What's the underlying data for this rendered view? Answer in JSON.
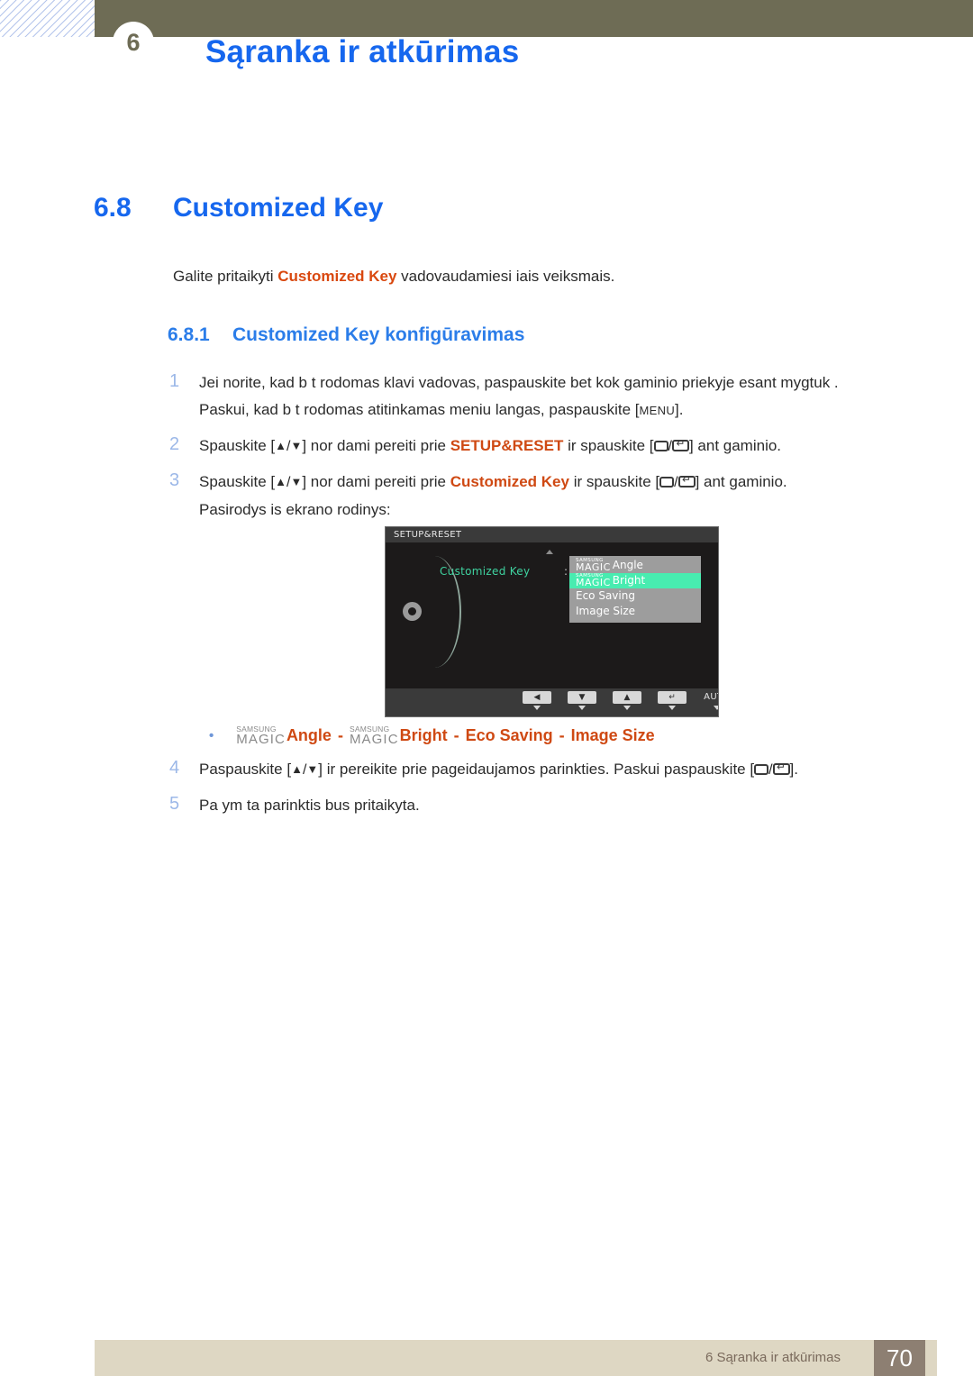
{
  "header": {
    "chapter_badge": "6",
    "chapter_title": "Sąranka ir atkūrimas"
  },
  "section": {
    "number": "6.8",
    "title": "Customized Key"
  },
  "intro": {
    "before": "Galite pritaikyti ",
    "keyword": "Customized Key",
    "after": " vadovaudamiesi  iais veiksmais."
  },
  "subsection": {
    "number": "6.8.1",
    "title": "Customized Key konfigūravimas"
  },
  "steps": [
    {
      "num": "1",
      "line1_a": "Jei norite, kad b t  rodomas klavi",
      "line1_b": " vadovas, paspauskite bet kok  gaminio priekyje esant  mygtuk  .",
      "line2_a": "Paskui, kad b t  rodomas atitinkamas meniu langas, paspauskite [",
      "menu_tag": "MENU",
      "line2_b": "]."
    },
    {
      "num": "2",
      "a": "Spauskite [",
      "b": "] nor dami pereiti prie ",
      "keyword": "SETUP&RESET",
      "c": " ir spauskite [",
      "d": "] ant gaminio."
    },
    {
      "num": "3",
      "a": "Spauskite [",
      "b": "] nor dami pereiti prie ",
      "keyword": "Customized Key",
      "c": " ir spauskite [",
      "d": "] ant gaminio.",
      "line2": "Pasirodys  is ekrano rodinys:"
    },
    {
      "num": "4",
      "a": "Paspauskite [",
      "b": "] ir pereikite prie pageidaujamos parinkties. Paskui paspauskite [",
      "c": "]."
    },
    {
      "num": "5",
      "a": "Pa ym ta parinktis bus pritaikyta."
    }
  ],
  "osd": {
    "title": "SETUP&RESET",
    "menu_label": "Customized Key",
    "colon": ":",
    "items": [
      {
        "magic_top": "SAMSUNG",
        "magic_bot": "MAGIC",
        "label": "Angle",
        "selected": false
      },
      {
        "magic_top": "SAMSUNG",
        "magic_bot": "MAGIC",
        "label": "Bright",
        "selected": true
      },
      {
        "magic_top": "",
        "magic_bot": "",
        "label": "Eco Saving",
        "selected": false
      },
      {
        "magic_top": "",
        "magic_bot": "",
        "label": "Image Size",
        "selected": false
      }
    ],
    "buttons": [
      {
        "glyph": "◀",
        "name": "left-arrow"
      },
      {
        "glyph": "▼",
        "name": "down-arrow"
      },
      {
        "glyph": "▲",
        "name": "up-arrow"
      },
      {
        "glyph": "↵",
        "name": "enter"
      },
      {
        "glyph": "AUTO",
        "name": "auto"
      },
      {
        "glyph": "⏻",
        "name": "power"
      }
    ],
    "colors": {
      "background": "#1c1a1a",
      "titlebar": "#3a3a3a",
      "label_teal": "#3fd3a0",
      "list_bg": "#9d9d9d",
      "highlight": "#48ecb0"
    }
  },
  "bullet": {
    "dot": "•",
    "magic_top": "SAMSUNG",
    "magic_bot": "MAGIC",
    "item1": "Angle",
    "item2": "Bright",
    "item3": "Eco Saving",
    "item4": "Image Size",
    "separator": "-"
  },
  "footer": {
    "text": "6 Sąranka ir atkūrimas",
    "page": "70"
  },
  "colors": {
    "heading_blue": "#1667ee",
    "subheading_blue": "#2b7de9",
    "keyword_orange": "#cf4913",
    "olive": "#6e6c55",
    "footer_bg": "#ded7c3",
    "footer_page_bg": "#8d7f72"
  }
}
